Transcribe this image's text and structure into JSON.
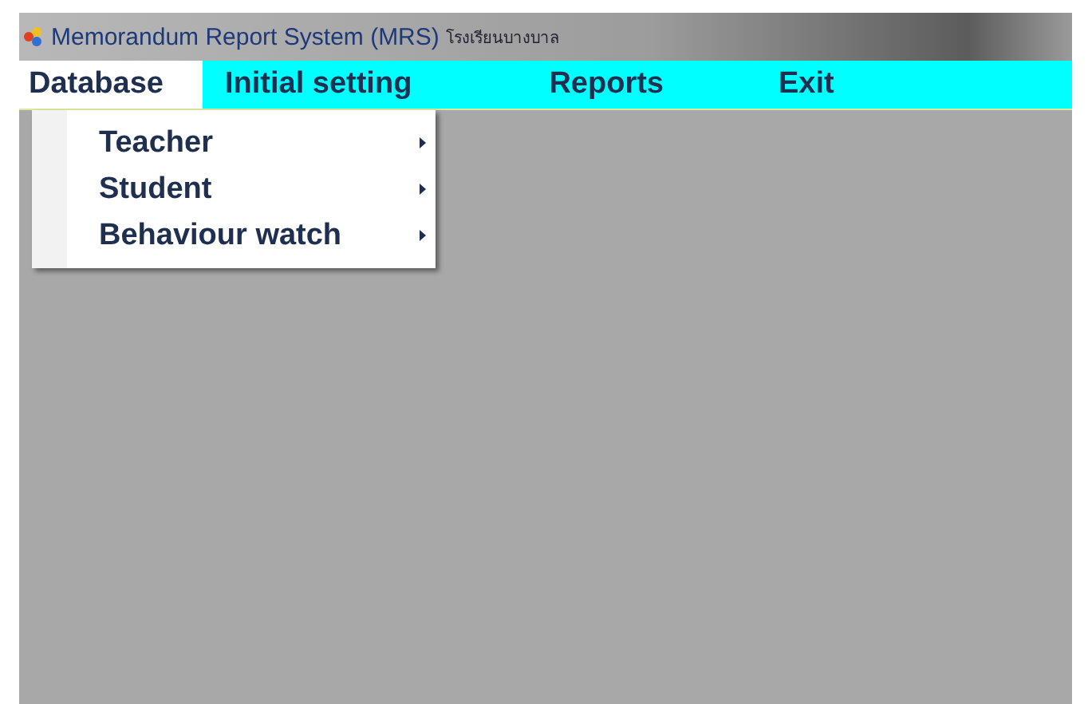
{
  "window": {
    "title": "Memorandum  Report System (MRS)",
    "subtitle": "โรงเรียนบางบาล"
  },
  "menu": [
    {
      "label": "Database",
      "selected": true
    },
    {
      "label": "Initial setting",
      "selected": false
    },
    {
      "label": "Reports",
      "selected": false
    },
    {
      "label": "Exit",
      "selected": false
    }
  ],
  "dropdown": [
    {
      "label": "Teacher",
      "submenu": true
    },
    {
      "label": "Student",
      "submenu": true
    },
    {
      "label": "Behaviour watch",
      "submenu": true
    }
  ]
}
